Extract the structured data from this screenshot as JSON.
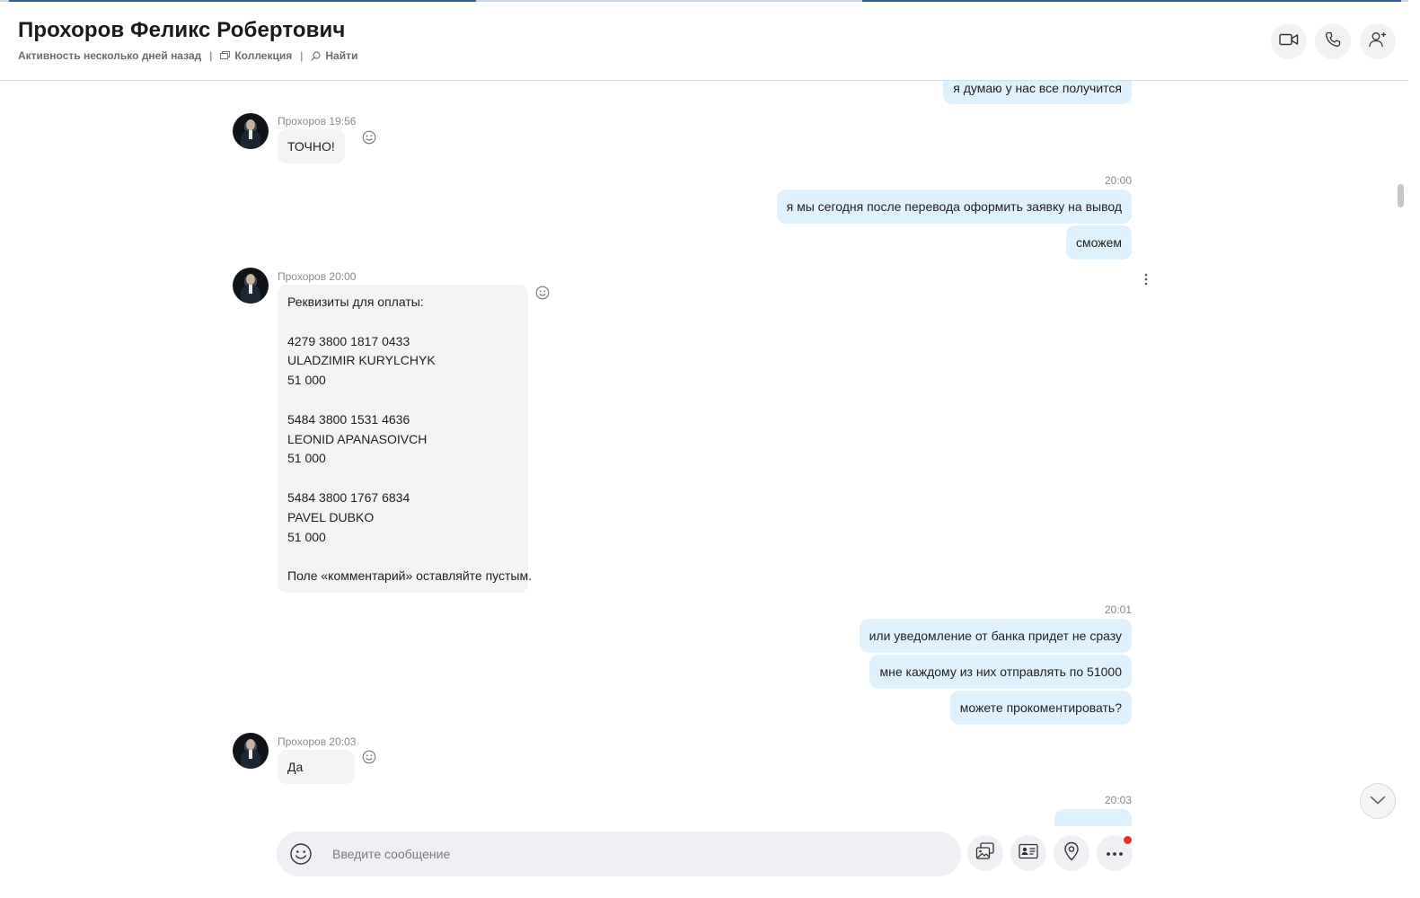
{
  "header": {
    "name": "Прохоров Феликс Робертович",
    "activity": "Активность несколько дней назад",
    "collection_label": "Коллекция",
    "find_label": "Найти",
    "icons": [
      "video-call-icon",
      "audio-call-icon",
      "add-person-icon"
    ]
  },
  "messages": {
    "m0_text": "я думаю у нас все получится",
    "m1_meta": "Прохоров 19:56",
    "m1_text": "ТОЧНО!",
    "m2_time": "20:00",
    "m2_text": "я мы сегодня после перевода оформить заявку на вывод",
    "m3_text": "сможем",
    "m4_meta": "Прохоров 20:00",
    "m4_text": "Реквизиты для оплаты:\n\n4279 3800 1817 0433\nULADZIMIR KURYLCHYK\n51 000\n\n5484 3800 1531 4636\nLEONID APANASOIVCH\n51 000\n\n5484 3800 1767 6834\nPAVEL DUBKO\n51 000\n\nПоле «комментарий» оставляйте пустым.",
    "m5_time": "20:01",
    "m5_text": "или уведомление от банка придет не сразу",
    "m6_text": "мне каждому из них отправлять по 51000",
    "m7_text": "можете прокоментировать?",
    "m8_meta": "Прохоров 20:03",
    "m8_text": "Да",
    "m9_time": "20:03"
  },
  "composer": {
    "placeholder": "Введите сообщение",
    "buttons": [
      "media-gallery-icon",
      "contact-card-icon",
      "location-pin-icon",
      "more-options-icon"
    ]
  },
  "colors": {
    "outgoing_bubble": "#dff1fc",
    "incoming_bubble": "#f1f3f5",
    "notification": "#e5322d"
  }
}
